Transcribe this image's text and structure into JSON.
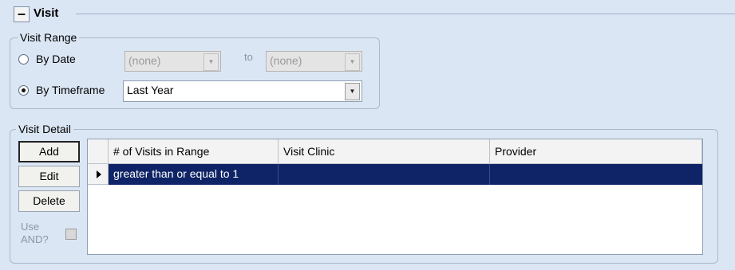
{
  "section": {
    "collapse_symbol": "–",
    "title": "Visit"
  },
  "visit_range": {
    "label": "Visit Range",
    "by_date_label": "By Date",
    "from_value": "(none)",
    "to_label": "to",
    "to_value": "(none)",
    "by_timeframe_label": "By Timeframe",
    "timeframe_value": "Last Year",
    "selected": "By Timeframe"
  },
  "visit_detail": {
    "label": "Visit Detail",
    "buttons": {
      "add": "Add",
      "edit": "Edit",
      "delete": "Delete"
    },
    "use_and_label": "Use AND?",
    "use_and_checked": false,
    "grid": {
      "columns": [
        "# of Visits in Range",
        "Visit Clinic",
        "Provider"
      ],
      "rows": [
        {
          "visits": "greater than or equal to 1",
          "clinic": "",
          "provider": ""
        }
      ]
    }
  },
  "colors": {
    "background": "#dbe6f4",
    "selected_row": "#0f2466"
  },
  "icons": {
    "dropdown": "chevron-down-icon",
    "row_pointer": "row-pointer-icon"
  }
}
